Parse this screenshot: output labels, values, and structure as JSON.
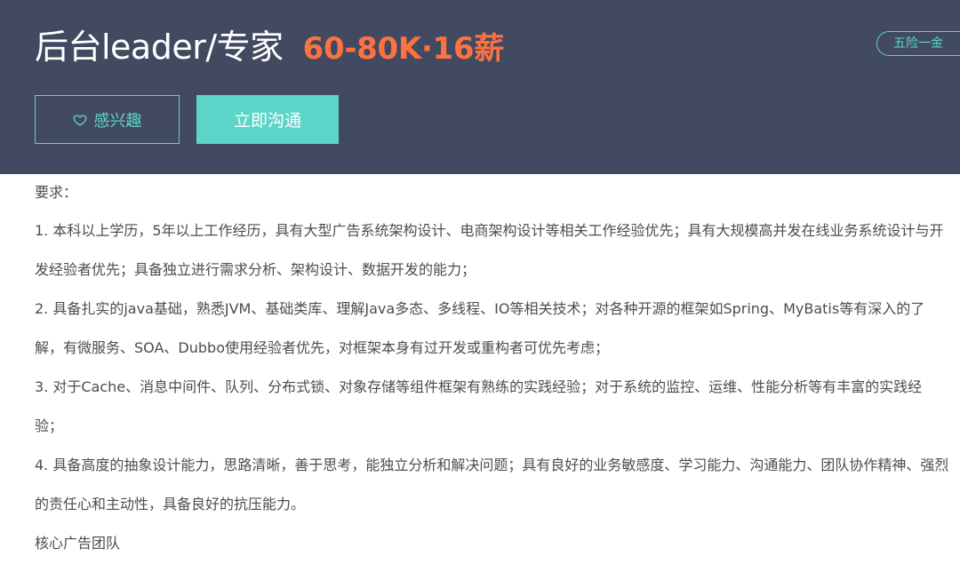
{
  "header": {
    "job_title": "后台leader/专家",
    "salary": "60-80K·16薪",
    "benefit_tag": "五险一金",
    "interest_button": "感兴趣",
    "chat_button": "立即沟通"
  },
  "description": {
    "heading": "要求：",
    "items": [
      "1. 本科以上学历，5年以上工作经历，具有大型广告系统架构设计、电商架构设计等相关工作经验优先；具有大规模高并发在线业务系统设计与开发经验者优先；具备独立进行需求分析、架构设计、数据开发的能力；",
      "2. 具备扎实的java基础，熟悉JVM、基础类库、理解Java多态、多线程、IO等相关技术；对各种开源的框架如Spring、MyBatis等有深入的了解，有微服务、SOA、Dubbo使用经验者优先，对框架本身有过开发或重构者可优先考虑；",
      "3. 对于Cache、消息中间件、队列、分布式锁、对象存储等组件框架有熟练的实践经验；对于系统的监控、运维、性能分析等有丰富的实践经验；",
      "4. 具备高度的抽象设计能力，思路清晰，善于思考，能独立分析和解决问题；具有良好的业务敏感度、学习能力、沟通能力、团队协作精神、强烈的责任心和主动性，具备良好的抗压能力。"
    ],
    "team": "核心广告团队"
  },
  "colors": {
    "header_bg": "#414a60",
    "accent": "#5dd5c8",
    "salary": "#fd7240",
    "text": "#4d4d4d"
  }
}
